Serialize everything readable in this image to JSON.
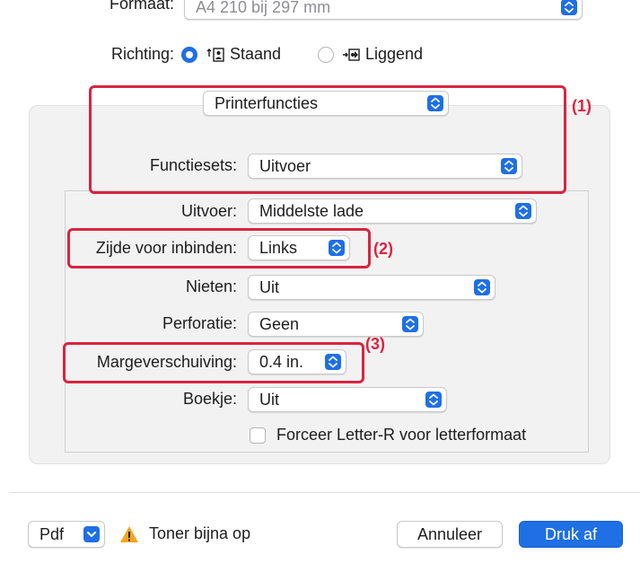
{
  "format": {
    "label": "Formaat:",
    "value": "A4 210 bij 297 mm"
  },
  "orientation": {
    "label": "Richting:",
    "portrait_label": "Staand",
    "landscape_label": "Liggend",
    "selected": "Staand"
  },
  "section_popup": {
    "value": "Printerfuncties"
  },
  "feature_sets": {
    "label": "Functiesets:",
    "value": "Uitvoer"
  },
  "fields": {
    "output": {
      "label": "Uitvoer:",
      "value": "Middelste lade"
    },
    "binding_edge": {
      "label": "Zijde voor inbinden:",
      "value": "Links"
    },
    "staple": {
      "label": "Nieten:",
      "value": "Uit"
    },
    "punch": {
      "label": "Perforatie:",
      "value": "Geen"
    },
    "margin_shift": {
      "label": "Margeverschuiving:",
      "value": "0.4 in."
    },
    "booklet": {
      "label": "Boekje:",
      "value": "Uit"
    }
  },
  "force_letter": {
    "label": "Forceer Letter-R voor letterformaat",
    "checked": false
  },
  "callouts": {
    "c1": "(1)",
    "c2": "(2)",
    "c3": "(3)"
  },
  "footer": {
    "pdf_label": "Pdf",
    "warning_text": "Toner bijna op",
    "cancel_label": "Annuleer",
    "print_label": "Druk af"
  },
  "colors": {
    "accent": "#1f6fe5",
    "callout_red": "#d9243f",
    "warning": "#f5a623"
  }
}
